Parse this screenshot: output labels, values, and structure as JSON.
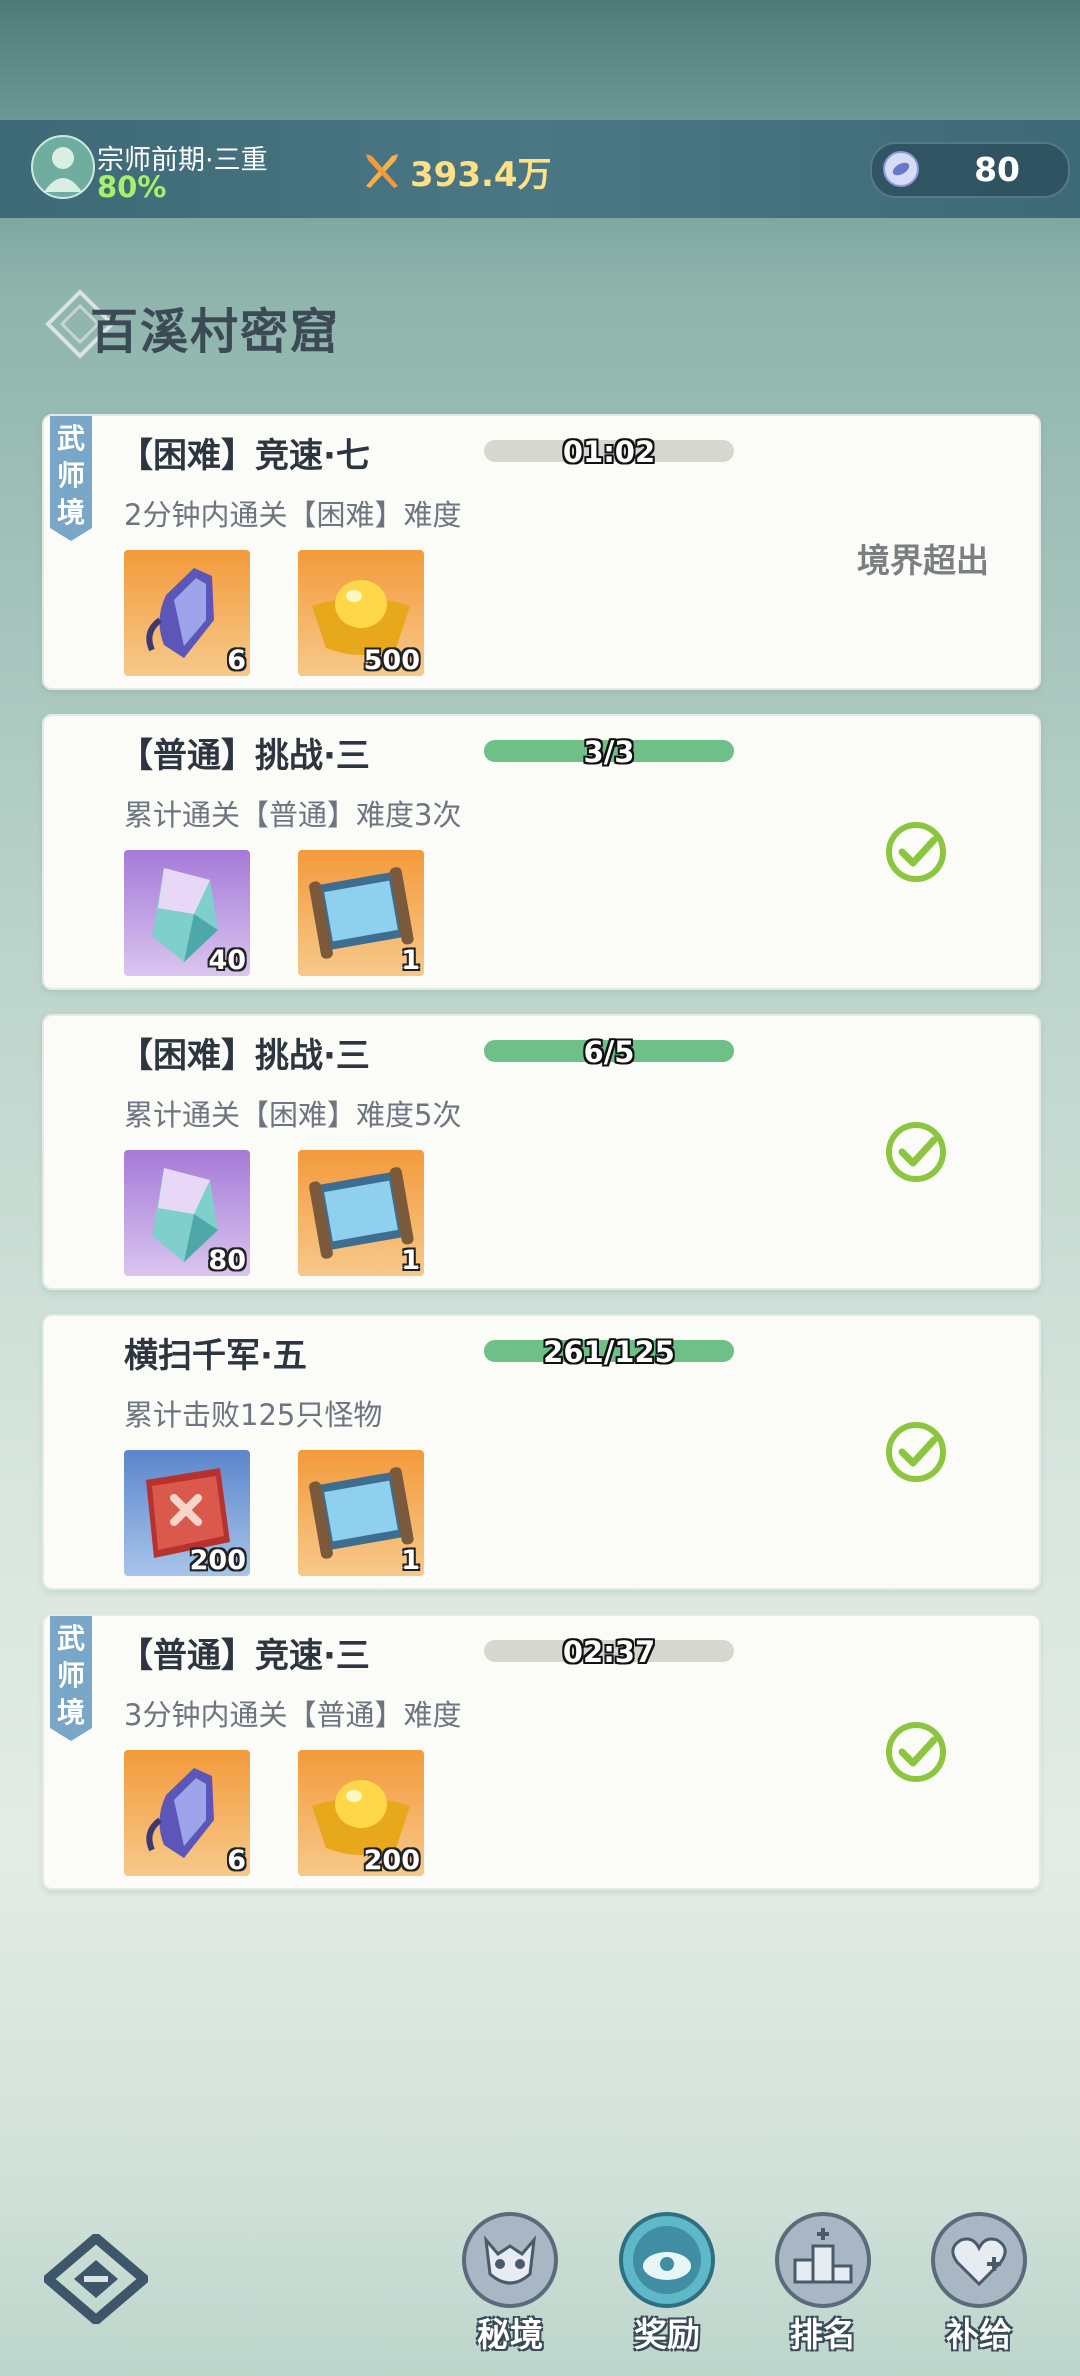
{
  "header": {
    "rank": "宗师前期·三重",
    "progress": "80%",
    "power": "393.4万",
    "currency": "80"
  },
  "page_title": "百溪村密窟",
  "quests": [
    {
      "badge": "武师境",
      "title": "【困难】竞速·七",
      "bar_text": "01:02",
      "bar_fill": 0,
      "desc": "2分钟内通关【困难】难度",
      "rewards": [
        {
          "icon": "relic-shard-icon",
          "count": "6"
        },
        {
          "icon": "gold-ingot-icon",
          "count": "500"
        }
      ],
      "status": "境界超出"
    },
    {
      "title": "【普通】挑战·三",
      "bar_text": "3/3",
      "bar_fill": 1,
      "desc": "累计通关【普通】难度3次",
      "rewards": [
        {
          "icon": "crystal-icon",
          "count": "40"
        },
        {
          "icon": "scroll-icon",
          "count": "1"
        }
      ],
      "status": "completed"
    },
    {
      "title": "【困难】挑战·三",
      "bar_text": "6/5",
      "bar_fill": 1,
      "desc": "累计通关【困难】难度5次",
      "rewards": [
        {
          "icon": "crystal-icon",
          "count": "80"
        },
        {
          "icon": "scroll-icon",
          "count": "1"
        }
      ],
      "status": "completed"
    },
    {
      "title": "横扫千军·五",
      "bar_text": "261/125",
      "bar_fill": 1,
      "desc": "累计击败125只怪物",
      "rewards": [
        {
          "icon": "banner-icon",
          "count": "200"
        },
        {
          "icon": "scroll-icon",
          "count": "1"
        }
      ],
      "status": "completed"
    },
    {
      "badge": "武师境",
      "title": "【普通】竞速·三",
      "bar_text": "02:37",
      "bar_fill": 0,
      "desc": "3分钟内通关【普通】难度",
      "rewards": [
        {
          "icon": "relic-shard-icon",
          "count": "6"
        },
        {
          "icon": "gold-ingot-icon",
          "count": "200"
        }
      ],
      "status": "completed"
    }
  ],
  "nav": [
    {
      "label": "秘境",
      "icon": "demon-mask-icon"
    },
    {
      "label": "奖励",
      "icon": "reward-chest-icon"
    },
    {
      "label": "排名",
      "icon": "ranking-podium-icon"
    },
    {
      "label": "补给",
      "icon": "supply-heart-icon"
    }
  ],
  "colors": {
    "accent_green": "#6fbf88",
    "check_green": "#8cc63f",
    "power_yellow": "#ffe084"
  }
}
